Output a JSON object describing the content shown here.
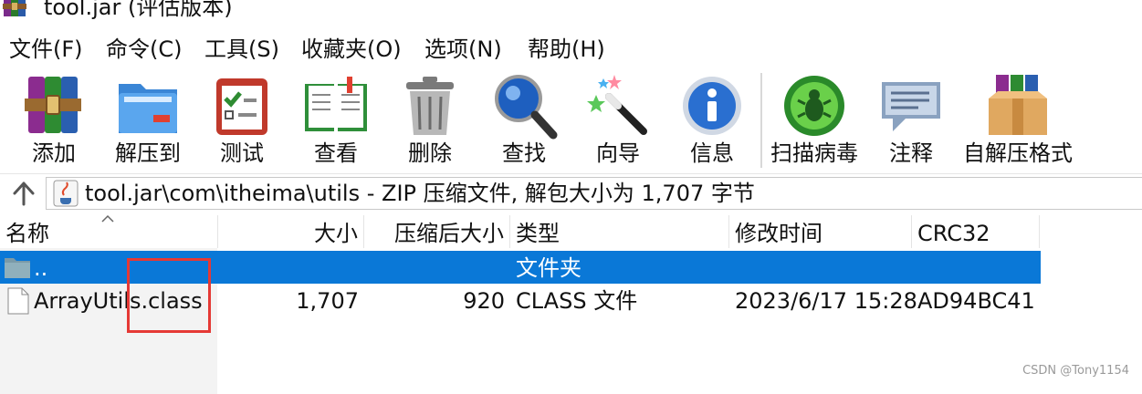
{
  "window": {
    "title": "tool.jar (评估版本)"
  },
  "menu": [
    "文件(F)",
    "命令(C)",
    "工具(S)",
    "收藏夹(O)",
    "选项(N)",
    "帮助(H)"
  ],
  "toolbar": [
    {
      "label": "添加",
      "icon": "add-archive-icon"
    },
    {
      "label": "解压到",
      "icon": "extract-to-icon"
    },
    {
      "label": "测试",
      "icon": "test-icon"
    },
    {
      "label": "查看",
      "icon": "view-book-icon"
    },
    {
      "label": "删除",
      "icon": "trash-icon"
    },
    {
      "label": "查找",
      "icon": "magnifier-icon"
    },
    {
      "label": "向导",
      "icon": "wizard-wand-icon"
    },
    {
      "label": "信息",
      "icon": "info-icon"
    },
    {
      "label": "扫描病毒",
      "icon": "virus-scan-icon"
    },
    {
      "label": "注释",
      "icon": "comment-icon"
    },
    {
      "label": "自解压格式",
      "icon": "sfx-box-icon"
    }
  ],
  "address": {
    "path": "tool.jar\\com\\itheima\\utils - ZIP 压缩文件, 解包大小为 1,707 字节"
  },
  "columns": [
    "名称",
    "大小",
    "压缩后大小",
    "类型",
    "修改时间",
    "CRC32"
  ],
  "rows": [
    {
      "name": "..",
      "size": "",
      "packed": "",
      "type": "文件夹",
      "modified": "",
      "crc": "",
      "selected": true
    },
    {
      "name": "ArrayUtils.class",
      "size": "1,707",
      "packed": "920",
      "type": "CLASS 文件",
      "modified": "2023/6/17 15:28",
      "crc": "AD94BC41",
      "selected": false
    }
  ],
  "watermark": "CSDN @Tony1154",
  "colors": {
    "selection": "#0a78d7",
    "annotation": "#e53935"
  }
}
